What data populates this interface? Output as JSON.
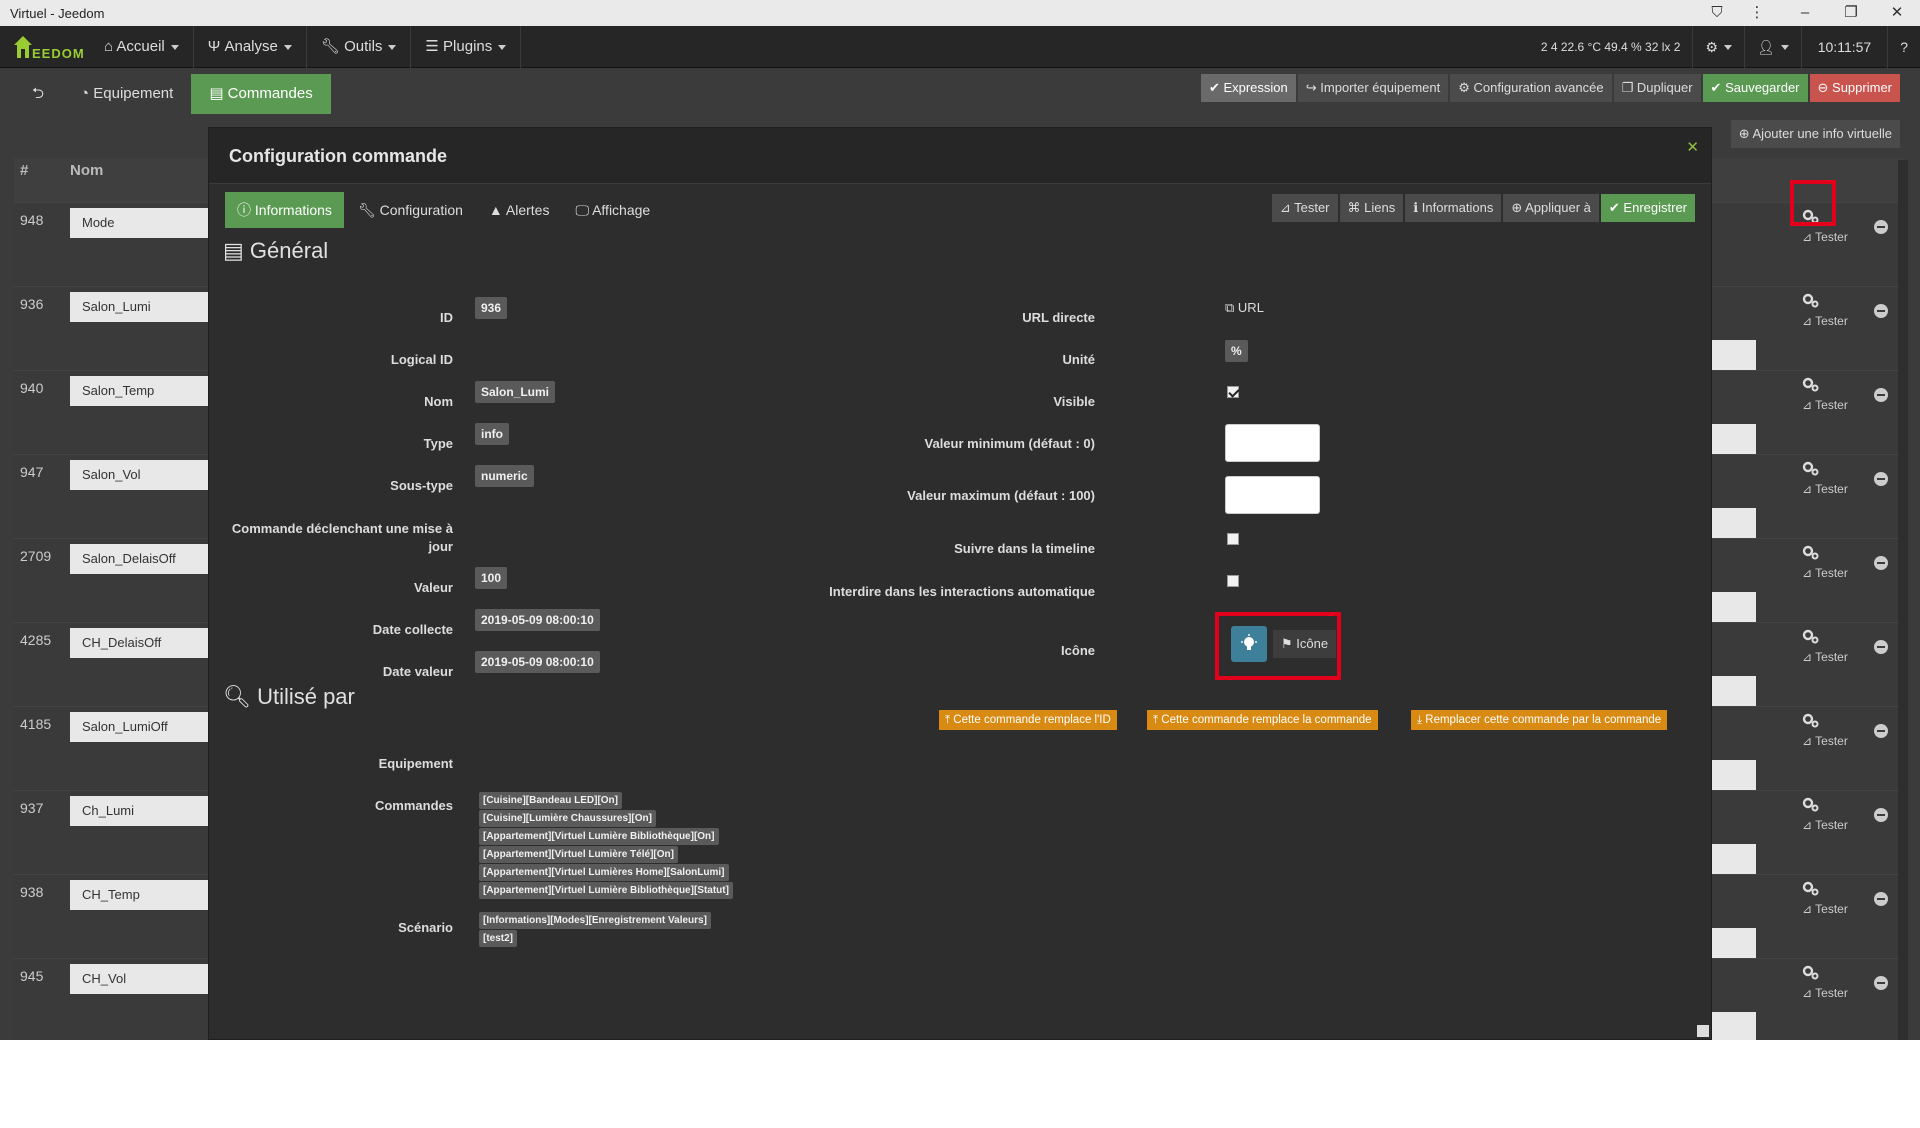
{
  "window": {
    "title": "Virtuel - Jeedom"
  },
  "navbar": {
    "logo_text": "EEDOM",
    "menu": [
      {
        "label": "Accueil",
        "icon": "home-icon"
      },
      {
        "label": "Analyse",
        "icon": "stethoscope-icon"
      },
      {
        "label": "Outils",
        "icon": "wrench-icon"
      },
      {
        "label": "Plugins",
        "icon": "tasks-icon"
      }
    ],
    "sensors": "2  4  22.6 °C  49.4 %  32 lx  2",
    "clock": "10:11:57"
  },
  "page_tabs": [
    {
      "label": "",
      "icon": "back-arrow-icon"
    },
    {
      "label": "Equipement",
      "icon": "tachometer-icon"
    },
    {
      "label": "Commandes",
      "icon": "list-alt-icon"
    }
  ],
  "page_actions": {
    "expression": "Expression",
    "import": "Importer équipement",
    "advanced": "Configuration avancée",
    "duplicate": "Dupliquer",
    "save": "Sauvegarder",
    "delete": "Supprimer",
    "add_virtual_info": "Ajouter une info virtuelle"
  },
  "table": {
    "headers": {
      "id": "#",
      "name": "Nom"
    },
    "tester_label": "Tester",
    "rows": [
      {
        "id": "948",
        "name": "Mode"
      },
      {
        "id": "936",
        "name": "Salon_Lumi"
      },
      {
        "id": "940",
        "name": "Salon_Temp"
      },
      {
        "id": "947",
        "name": "Salon_Vol"
      },
      {
        "id": "2709",
        "name": "Salon_DelaisOff"
      },
      {
        "id": "4285",
        "name": "CH_DelaisOff"
      },
      {
        "id": "4185",
        "name": "Salon_LumiOff"
      },
      {
        "id": "937",
        "name": "Ch_Lumi"
      },
      {
        "id": "938",
        "name": "CH_Temp"
      },
      {
        "id": "945",
        "name": "CH_Vol"
      }
    ]
  },
  "modal": {
    "title": "Configuration commande",
    "tabs": [
      {
        "label": "Informations",
        "icon": "info-circle-icon"
      },
      {
        "label": "Configuration",
        "icon": "wrench-icon"
      },
      {
        "label": "Alertes",
        "icon": "warning-icon"
      },
      {
        "label": "Affichage",
        "icon": "desktop-icon"
      }
    ],
    "actions": {
      "test": "Tester",
      "links": "Liens",
      "info": "Informations",
      "apply": "Appliquer à",
      "save": "Enregistrer"
    },
    "general": {
      "section_title": "Général",
      "labels": {
        "id": "ID",
        "logical_id": "Logical ID",
        "name": "Nom",
        "type": "Type",
        "subtype": "Sous-type",
        "trigger": "Commande déclenchant une mise à jour",
        "value": "Valeur",
        "collect_date": "Date collecte",
        "value_date": "Date valeur"
      },
      "values": {
        "id": "936",
        "name": "Salon_Lumi",
        "type": "info",
        "subtype": "numeric",
        "value": "100",
        "collect_date": "2019-05-09 08:00:10",
        "value_date": "2019-05-09 08:00:10"
      },
      "right_labels": {
        "url": "URL directe",
        "unit": "Unité",
        "visible": "Visible",
        "min": "Valeur minimum (défaut : 0)",
        "max": "Valeur maximum (défaut : 100)",
        "timeline": "Suivre dans la timeline",
        "interact": "Interdire dans les interactions automatique",
        "icon": "Icône"
      },
      "right_values": {
        "url_link": "URL",
        "unit": "%",
        "visible": true,
        "timeline": false,
        "interact": false,
        "icon_button": "Icône"
      }
    },
    "used_by": {
      "section_title": "Utilisé par",
      "buttons": {
        "replace_id": "Cette commande remplace l'ID",
        "replace_cmd": "Cette commande remplace la commande",
        "replace_by": "Remplacer cette commande par la commande"
      },
      "labels": {
        "equipment": "Equipement",
        "commands": "Commandes",
        "scenario": "Scénario"
      },
      "commands": [
        "[Cuisine][Bandeau LED][On]",
        "[Cuisine][Lumière Chaussures][On]",
        "[Appartement][Virtuel Lumière Bibliothèque][On]",
        "[Appartement][Virtuel Lumière Télé][On]",
        "[Appartement][Virtuel Lumières Home][SalonLumi]",
        "[Appartement][Virtuel Lumière Bibliothèque][Statut]"
      ],
      "scenarios": [
        "[Informations][Modes][Enregistrement Valeurs]",
        "[test2]"
      ]
    }
  },
  "colors": {
    "accent_green": "#5b9a52",
    "danger_red": "#c9534d",
    "warning_orange": "#d98a12",
    "highlight": "#e3001b"
  }
}
